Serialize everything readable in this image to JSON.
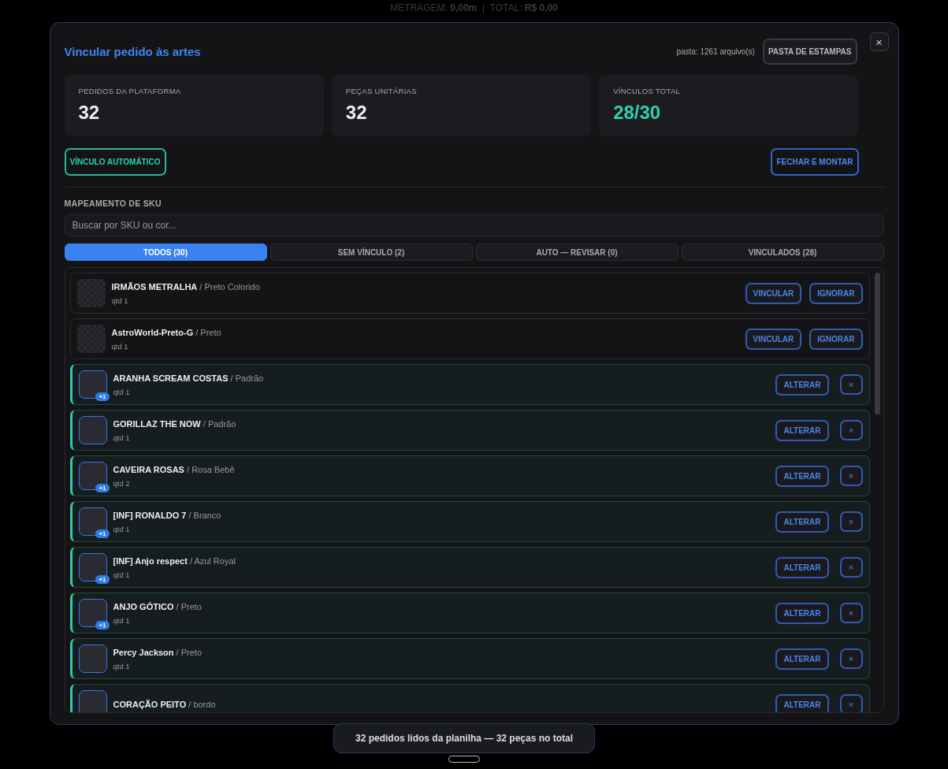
{
  "background_text": "METRAGEM: **0,00m**  |  TOTAL: **R$ 0,00**",
  "modal": {
    "title": "Vincular pedido às artes",
    "folder_info": "pasta: 1261 arquivo(s)",
    "folder_button": "PASTA DE ESTAMPAS",
    "close": "×"
  },
  "stats": [
    {
      "label": "PEDIDOS DA PLATAFORMA",
      "value": "32",
      "kind": "plain"
    },
    {
      "label": "PEÇAS UNITÁRIAS",
      "value": "32",
      "kind": "plain"
    },
    {
      "label": "VÍNCULOS TOTAL",
      "value": "28/30",
      "kind": "accent"
    }
  ],
  "actions": {
    "auto_button": "VÍNCULO AUTOMÁTICO",
    "finish_button": "FECHAR E MONTAR"
  },
  "section_title": "MAPEAMENTO DE SKU",
  "search": {
    "placeholder": "Buscar por SKU ou cor..."
  },
  "tabs": [
    {
      "label": "TODOS (30)",
      "selected": true
    },
    {
      "label": "SEM VÍNCULO (2)",
      "selected": false
    },
    {
      "label": "AUTO — REVISAR (0)",
      "selected": false
    },
    {
      "label": "VINCULADOS (28)",
      "selected": false
    }
  ],
  "items": [
    {
      "kind": "unlinked",
      "title": "**IRMÃOS METRALHA** / Preto Colorido",
      "qty": "qtd 1",
      "actions": [
        "VINCULAR",
        "IGNORAR"
      ]
    },
    {
      "kind": "unlinked",
      "title": "**AstroWorld-Preto-G** / Preto",
      "qty": "qtd 1",
      "actions": [
        "VINCULAR",
        "IGNORAR"
      ]
    },
    {
      "kind": "linked",
      "title": "**ARANHA SCREAM COSTAS** / Padrão",
      "qty": "qtd 1",
      "extra": "+1",
      "actions": [
        "ALTERAR",
        "×"
      ]
    },
    {
      "kind": "linked",
      "title": "**GORILLAZ THE NOW** / Padrão",
      "qty": "qtd 1",
      "actions": [
        "ALTERAR",
        "×"
      ]
    },
    {
      "kind": "linked",
      "title": "**CAVEIRA ROSAS** / Rosa Bebê",
      "qty": "qtd 2",
      "extra": "+1",
      "actions": [
        "ALTERAR",
        "×"
      ]
    },
    {
      "kind": "linked",
      "title": "**[INF] RONALDO 7** / Branco",
      "qty": "qtd 1",
      "extra": "+1",
      "actions": [
        "ALTERAR",
        "×"
      ]
    },
    {
      "kind": "linked",
      "title": "**[INF] Anjo respect** / Azul Royal",
      "qty": "qtd 1",
      "extra": "+1",
      "actions": [
        "ALTERAR",
        "×"
      ]
    },
    {
      "kind": "linked",
      "title": "**ANJO GÓTICO** / Preto",
      "qty": "qtd 1",
      "extra": "+1",
      "actions": [
        "ALTERAR",
        "×"
      ]
    },
    {
      "kind": "linked",
      "title": "**Percy Jackson** / Preto",
      "qty": "qtd 1",
      "actions": [
        "ALTERAR",
        "×"
      ]
    },
    {
      "kind": "linked",
      "title": "**CORAÇÃO PEITO** / bordo",
      "actions": [
        "ALTERAR",
        "×"
      ]
    }
  ],
  "toast": "32 pedidos lidos da planilha — 32 peças no total"
}
